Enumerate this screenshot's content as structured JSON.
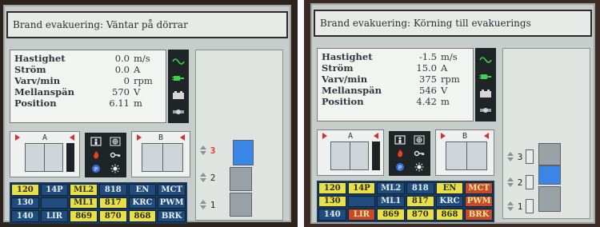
{
  "left": {
    "header": "Brand evakuering: Väntar på dörrar",
    "readings": [
      {
        "label": "Hastighet",
        "value": "0.0",
        "unit": "m/s"
      },
      {
        "label": "Ström",
        "value": "0.0",
        "unit": "A"
      },
      {
        "label": "Varv/min",
        "value": "0",
        "unit": "rpm"
      },
      {
        "label": "Mellanspän",
        "value": "570",
        "unit": "V"
      },
      {
        "label": "Position",
        "value": "6.11",
        "unit": "m"
      }
    ],
    "doors": {
      "a": "A",
      "b": "B"
    },
    "floors": [
      {
        "label": "3",
        "current": true
      },
      {
        "label": "2",
        "current": false
      },
      {
        "label": "1",
        "current": false
      }
    ],
    "grid": [
      [
        {
          "text": "120",
          "color": "yellow"
        },
        {
          "text": "14P",
          "color": "blue"
        },
        {
          "text": "ML2",
          "color": "yellow"
        },
        {
          "text": "818",
          "color": "blue"
        },
        {
          "text": "EN",
          "color": "blue"
        },
        {
          "text": "MCT",
          "color": "blue"
        }
      ],
      [
        {
          "text": "130",
          "color": "blue"
        },
        {
          "text": "",
          "color": "blue"
        },
        {
          "text": "ML1",
          "color": "yellow"
        },
        {
          "text": "817",
          "color": "yellow"
        },
        {
          "text": "KRC",
          "color": "blue"
        },
        {
          "text": "PWM",
          "color": "blue"
        }
      ],
      [
        {
          "text": "140",
          "color": "blue"
        },
        {
          "text": "LIR",
          "color": "blue"
        },
        {
          "text": "869",
          "color": "yellow"
        },
        {
          "text": "870",
          "color": "yellow"
        },
        {
          "text": "868",
          "color": "yellow"
        },
        {
          "text": "BRK",
          "color": "blue"
        }
      ]
    ]
  },
  "right": {
    "header": "Brand evakuering: Körning till evakuerings",
    "readings": [
      {
        "label": "Hastighet",
        "value": "-1.5",
        "unit": "m/s"
      },
      {
        "label": "Ström",
        "value": "15.0",
        "unit": "A"
      },
      {
        "label": "Varv/min",
        "value": "375",
        "unit": "rpm"
      },
      {
        "label": "Mellanspän",
        "value": "546",
        "unit": "V"
      },
      {
        "label": "Position",
        "value": "4.42",
        "unit": "m"
      }
    ],
    "doors": {
      "a": "A",
      "b": "B"
    },
    "floors": [
      {
        "label": "3",
        "current": false
      },
      {
        "label": "2",
        "current": false
      },
      {
        "label": "1",
        "current": false
      }
    ],
    "grid": [
      [
        {
          "text": "120",
          "color": "yellow"
        },
        {
          "text": "14P",
          "color": "yellow"
        },
        {
          "text": "ML2",
          "color": "blue"
        },
        {
          "text": "818",
          "color": "blue"
        },
        {
          "text": "EN",
          "color": "yellow"
        },
        {
          "text": "MCT",
          "color": "red"
        }
      ],
      [
        {
          "text": "130",
          "color": "yellow"
        },
        {
          "text": "",
          "color": "blue"
        },
        {
          "text": "ML1",
          "color": "blue"
        },
        {
          "text": "817",
          "color": "yellow"
        },
        {
          "text": "KRC",
          "color": "blue"
        },
        {
          "text": "PWM",
          "color": "red"
        }
      ],
      [
        {
          "text": "140",
          "color": "blue"
        },
        {
          "text": "LIR",
          "color": "red"
        },
        {
          "text": "869",
          "color": "yellow"
        },
        {
          "text": "870",
          "color": "yellow"
        },
        {
          "text": "868",
          "color": "yellow"
        },
        {
          "text": "BRK",
          "color": "red"
        }
      ]
    ]
  },
  "icons": {
    "status": [
      "sine-wave-icon",
      "plug-icon",
      "battery-icon",
      "brake-icon"
    ],
    "middle": [
      "car-occupancy-icon",
      "fan-icon",
      "fire-icon",
      "key-icon",
      "parking-icon",
      "light-icon"
    ]
  }
}
